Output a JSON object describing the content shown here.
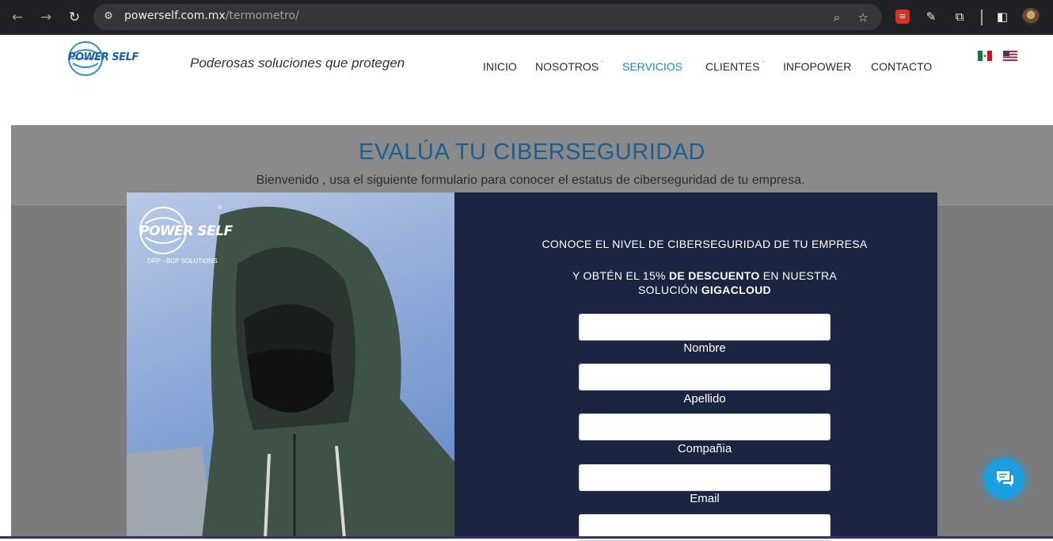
{
  "browser": {
    "url_host": "powerself.com.mx",
    "url_path": "/termometro/"
  },
  "header": {
    "logo_text": "POWER SELF",
    "tagline": "Poderosas soluciones que protegen",
    "menu": [
      {
        "label": "INICIO",
        "has_caret": false
      },
      {
        "label": "NOSOTROS",
        "has_caret": true
      },
      {
        "label": "SERVICIOS",
        "has_caret": true,
        "active": true
      },
      {
        "label": "CLIENTES",
        "has_caret": true
      },
      {
        "label": "INFOPOWER",
        "has_caret": false
      },
      {
        "label": "CONTACTO",
        "has_caret": false
      }
    ],
    "caret": "˙"
  },
  "page": {
    "title": "EVALÚA TU CIBERSEGURIDAD",
    "subtitle": "Bienvenido , usa el siguiente formulario para conocer el estatus de ciberseguridad de tu empresa."
  },
  "modal": {
    "photo_logo": "POWER SELF",
    "photo_logo_sub": "DRP - BCP SOLUTIONS",
    "heading": "CONOCE EL NIVEL DE CIBERSEGURIDAD DE TU EMPRESA",
    "offer_part1": "Y OBTÉN EL 15% ",
    "offer_bold1": "DE DESCUENTO",
    "offer_part2": " EN NUESTRA",
    "offer_part3": "SOLUCIÓN ",
    "offer_bold2": "GIGACLOUD",
    "fields": [
      {
        "label": "Nombre",
        "value": ""
      },
      {
        "label": "Apellido",
        "value": ""
      },
      {
        "label": "Compañia",
        "value": ""
      },
      {
        "label": "Email",
        "value": ""
      },
      {
        "label": "",
        "value": ""
      }
    ]
  },
  "colors": {
    "accent": "#1a87c5",
    "modal_bg": "#1b2541",
    "chat": "#1b9fe0"
  }
}
